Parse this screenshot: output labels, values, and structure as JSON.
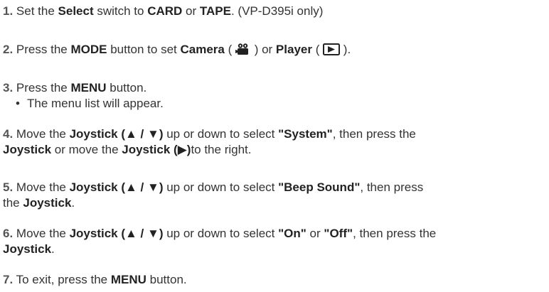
{
  "steps": [
    {
      "num": "1.",
      "p1": "Set the ",
      "b1": "Select",
      "p2": " switch to ",
      "b2": "CARD",
      "p3": " or ",
      "b3": "TAPE",
      "p4": ". (VP-D395i only)"
    },
    {
      "num": "2.",
      "p1": "Press the ",
      "b1": "MODE",
      "p2": " button to set ",
      "b2": "Camera",
      "p3": " ( ",
      "p4": " ) or ",
      "b3": "Player",
      "p5": " ( ",
      "p6": " ).",
      "icon1": "camera-mode-icon",
      "icon2": "player-mode-icon"
    },
    {
      "num": "3.",
      "p1": "Press the ",
      "b1": "MENU",
      "p2": " button.",
      "bullet_char": "•",
      "bullet": "The menu list will appear."
    },
    {
      "num": "4.",
      "p1": "Move the ",
      "b1": "Joystick (▲ / ▼)",
      "p2": " up or down to select ",
      "b2": "\"System\"",
      "p3": ", then press the",
      "b3": "Joystick",
      "p4": " or move the ",
      "b4": "Joystick (▶)",
      "p5": "to the right."
    },
    {
      "num": "5.",
      "p1": "Move the ",
      "b1": "Joystick (▲ / ▼)",
      "p2": " up or down to select ",
      "b2": "\"Beep Sound\"",
      "p3": ", then press",
      "p4": "the ",
      "b3": "Joystick",
      "p5": "."
    },
    {
      "num": "6.",
      "p1": "Move the ",
      "b1": "Joystick (▲ / ▼)",
      "p2": " up or down to select ",
      "b2": "\"On\"",
      "p3": " or ",
      "b3": "\"Off\"",
      "p4": ", then press the",
      "b4": "Joystick",
      "p5": "."
    },
    {
      "num": "7.",
      "p1": "To exit, press the ",
      "b1": "MENU",
      "p2": " button."
    }
  ]
}
